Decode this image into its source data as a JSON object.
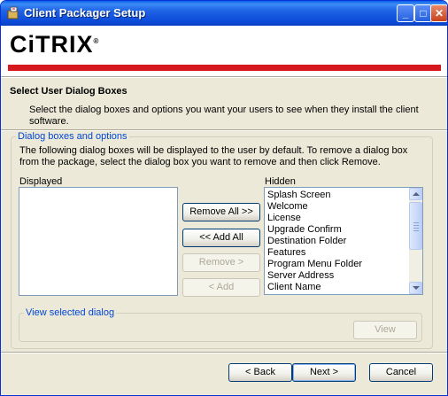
{
  "window": {
    "title": "Client Packager Setup",
    "controls": {
      "minimize": "_",
      "maximize": "□",
      "close": "✕"
    },
    "icon": "package-icon"
  },
  "banner": {
    "logo_text": "CiTRIX",
    "logo_mark": "®",
    "accent_color": "#d7181f"
  },
  "section": {
    "title": "Select User Dialog Boxes",
    "description": "Select the dialog boxes and options you want your users to see when they install the client software."
  },
  "dialog_group": {
    "legend": "Dialog boxes and options",
    "info": "The following dialog boxes will be displayed to the user by default. To remove a dialog box from the package, select the dialog box you want to remove and then click Remove.",
    "displayed_label": "Displayed",
    "hidden_label": "Hidden",
    "displayed_items": [],
    "hidden_items": [
      "Splash Screen",
      "Welcome",
      "License",
      "Upgrade Confirm",
      "Destination Folder",
      "Features",
      "Program Menu Folder",
      "Server Address",
      "Client Name"
    ]
  },
  "buttons": {
    "remove_all": "Remove All >>",
    "add_all": "<< Add All",
    "remove": "Remove >",
    "add": "< Add",
    "view": "View"
  },
  "view_group": {
    "legend": "View selected dialog"
  },
  "footer": {
    "back": "< Back",
    "next": "Next >",
    "cancel": "Cancel"
  }
}
